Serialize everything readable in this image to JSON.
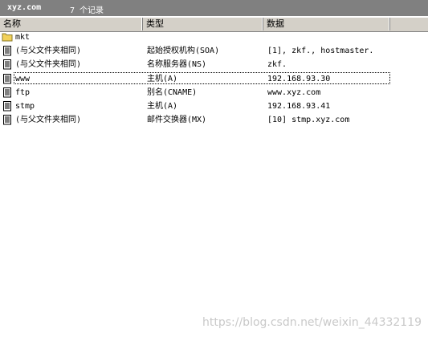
{
  "titlebar": {
    "domain": "xyz.com",
    "record_count": "7 个记录"
  },
  "columns": {
    "name": "名称",
    "type": "类型",
    "data": "数据"
  },
  "records": [
    {
      "icon": "folder-icon",
      "name": "mkt",
      "type": "",
      "data": ""
    },
    {
      "icon": "record-icon",
      "name": "(与父文件夹相同)",
      "type": "起始授权机构(SOA)",
      "data": "[1], zkf., hostmaster."
    },
    {
      "icon": "record-icon",
      "name": "(与父文件夹相同)",
      "type": "名称服务器(NS)",
      "data": "zkf."
    },
    {
      "icon": "record-icon",
      "name": "www",
      "type": "主机(A)",
      "data": "192.168.93.30",
      "focused": true
    },
    {
      "icon": "record-icon",
      "name": "ftp",
      "type": "别名(CNAME)",
      "data": "www.xyz.com"
    },
    {
      "icon": "record-icon",
      "name": "stmp",
      "type": "主机(A)",
      "data": "192.168.93.41"
    },
    {
      "icon": "record-icon",
      "name": "(与父文件夹相同)",
      "type": "邮件交换器(MX)",
      "data": "[10]  stmp.xyz.com"
    }
  ],
  "watermark": "https://blog.csdn.net/weixin_44332119",
  "colors": {
    "titlebar": "#808080",
    "header": "#d4d0c8",
    "folder": "#f2d15a"
  }
}
